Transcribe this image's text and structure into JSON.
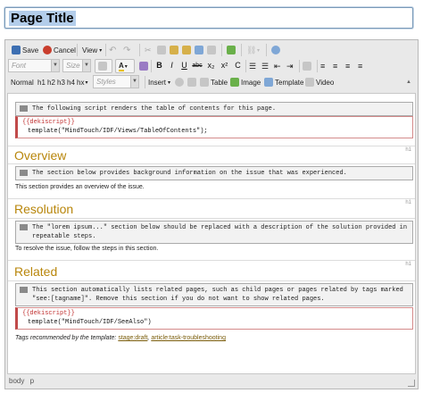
{
  "page_title": "Page Title",
  "toolbar": {
    "save": "Save",
    "cancel": "Cancel",
    "view": "View",
    "font_placeholder": "Font",
    "size_placeholder": "Size",
    "format_value": "Normal",
    "headings": [
      "h1",
      "h2",
      "h3",
      "h4"
    ],
    "headings_more": "hx",
    "styles_placeholder": "Styles",
    "insert": "Insert",
    "table": "Table",
    "image": "Image",
    "template": "Template",
    "video": "Video",
    "format_buttons": [
      "B",
      "I",
      "U",
      "abc",
      "x₂",
      "x²",
      "C"
    ]
  },
  "content": {
    "note1": "The following script renders the table of contents for this page.",
    "dek_label": "{{dekiscript}}",
    "dek1_code": "template(\"MindTouch/IDF/Views/TableOfContents\");",
    "h1_tag": "h1",
    "sections": [
      {
        "heading": "Overview",
        "note": "The section below provides background information on the issue that was experienced.",
        "text": "This section provides an overview of the issue."
      },
      {
        "heading": "Resolution",
        "note_line1": "The \"lorem ipsum...\" section below should be replaced with a description of the solution provided in",
        "note_line2": "repeatable steps.",
        "text": "To resolve the issue, follow the steps in this section."
      },
      {
        "heading": "Related",
        "note_line1": "This section automatically lists related pages, such as child pages or pages related by tags marked",
        "note_line2": "\"see:[tagname]\". Remove this section if you do not want to show related pages.",
        "dek_code": "template(\"MindTouch/IDF/SeeAlso\")"
      }
    ],
    "tags_prefix": "Tags recommended by the template:",
    "tag1": "stage:draft",
    "tag_sep": ",",
    "tag2": "article:task-troubleshooting"
  },
  "statusbar": {
    "path1": "body",
    "path2": "p"
  },
  "colors": {
    "heading": "#b8860b",
    "dekiscript_border": "#c14a4a",
    "title_highlight": "#b3cdea"
  }
}
